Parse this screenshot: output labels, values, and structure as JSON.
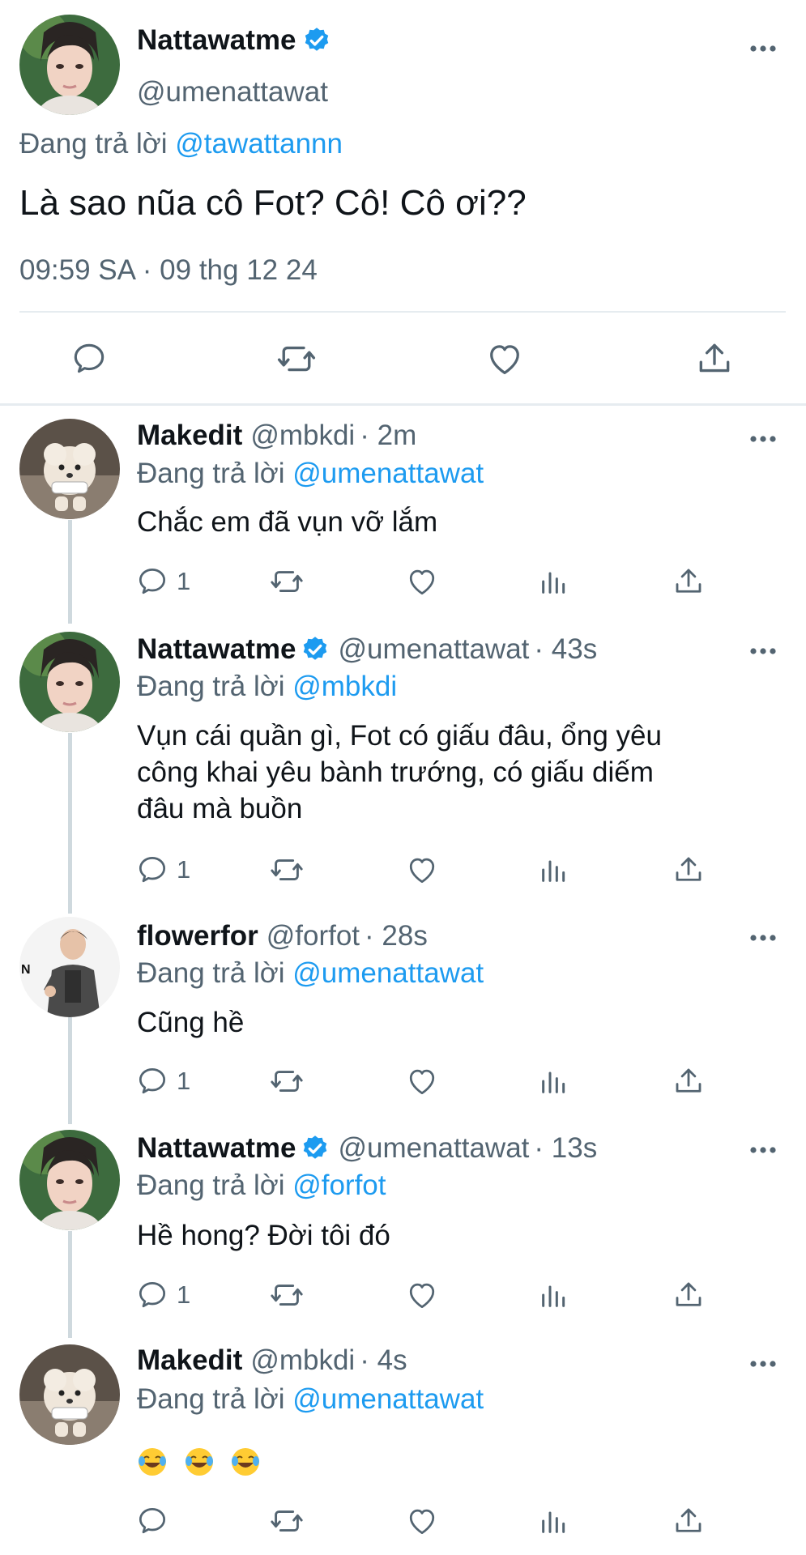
{
  "main_tweet": {
    "avatar": "portrait-avatar",
    "name": "Nattawatme",
    "verified": true,
    "handle": "@umenattawat",
    "replying_prefix": "Đang trả lời",
    "replying_to": "@tawattannn",
    "text": "Là sao nũa cô Fot? Cô! Cô ơi??",
    "timestamp": "09:59 SA · 09 thg 12 24",
    "actions": [
      "reply-icon",
      "retweet-icon",
      "like-icon",
      "share-icon"
    ]
  },
  "replies": [
    {
      "name": "Makedit",
      "handle": "@mbkdi",
      "time": "· 2m",
      "verified": false,
      "avatar": "dog-avatar",
      "replying_prefix": "Đang trả lời",
      "replying_to": "@umenattawat",
      "lines": [
        "Chắc em đã vụn vỡ lắm"
      ],
      "reply_count": "1"
    },
    {
      "name": "Nattawatme",
      "handle": "@umenattawat",
      "time": "· 43s",
      "verified": true,
      "avatar": "portrait-avatar",
      "replying_prefix": "Đang trả lời",
      "replying_to": "@mbkdi",
      "lines": [
        "Vụn cái quần gì, Fot có giấu đâu, ổng yêu",
        "công khai yêu bành trướng, có giấu diếm",
        "đâu mà buồn"
      ],
      "reply_count": "1"
    },
    {
      "name": "flowerfor",
      "handle": "@forfot",
      "time": "· 28s",
      "verified": false,
      "avatar": "person-avatar",
      "replying_prefix": "Đang trả lời",
      "replying_to": "@umenattawat",
      "lines": [
        "Cũng hề"
      ],
      "reply_count": "1"
    },
    {
      "name": "Nattawatme",
      "handle": "@umenattawat",
      "time": "· 13s",
      "verified": true,
      "avatar": "portrait-avatar",
      "replying_prefix": "Đang trả lời",
      "replying_to": "@forfot",
      "lines": [
        "Hề hong? Đời tôi đó"
      ],
      "reply_count": "1"
    },
    {
      "name": "Makedit",
      "handle": "@mbkdi",
      "time": "· 4s",
      "verified": false,
      "avatar": "dog-avatar",
      "replying_prefix": "Đang trả lời",
      "replying_to": "@umenattawat",
      "lines": [],
      "emoji": [
        "laughing-crying-emoji",
        "laughing-crying-emoji",
        "laughing-crying-emoji"
      ],
      "reply_count": ""
    }
  ],
  "colors": {
    "link": "#1d9bf0",
    "secondary_text": "#536471",
    "divider": "#e6ecf0",
    "thread_line": "#cfd9de"
  }
}
